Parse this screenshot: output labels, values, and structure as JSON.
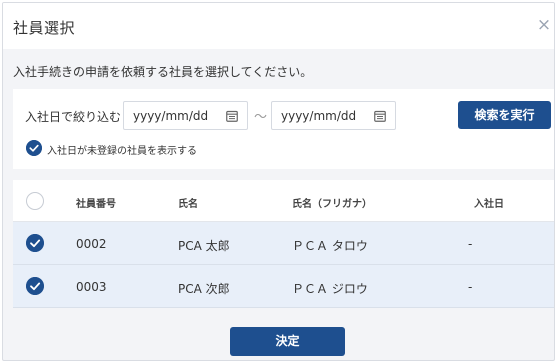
{
  "dialog": {
    "title": "社員選択",
    "close_glyph": "×",
    "instruction": "入社手続きの申請を依頼する社員を選択してください。"
  },
  "filter": {
    "label": "入社日で絞り込む",
    "from_placeholder": "yyyy/mm/dd",
    "to_placeholder": "yyyy/mm/dd",
    "range_separator": "〜",
    "search_button": "検索を実行",
    "show_unregistered_label": "入社日が未登録の社員を表示する",
    "show_unregistered_checked": true
  },
  "table": {
    "columns": {
      "employee_no": "社員番号",
      "name": "氏名",
      "name_kana": "氏名（フリガナ）",
      "join_date": "入社日"
    },
    "rows": [
      {
        "selected": true,
        "employee_no": "0002",
        "name": "PCA 太郎",
        "name_kana": "ＰＣＡ タロウ",
        "join_date": "-"
      },
      {
        "selected": true,
        "employee_no": "0003",
        "name": "PCA 次郎",
        "name_kana": "ＰＣＡ ジロウ",
        "join_date": "-"
      }
    ]
  },
  "footer": {
    "confirm_button": "決定"
  },
  "colors": {
    "accent": "#1e4f8f",
    "row_selected_bg": "#e8eff9",
    "dialog_bg": "#f3f4f7"
  },
  "icons": {
    "close": "close-icon",
    "calendar": "calendar-icon",
    "check": "check-icon"
  }
}
